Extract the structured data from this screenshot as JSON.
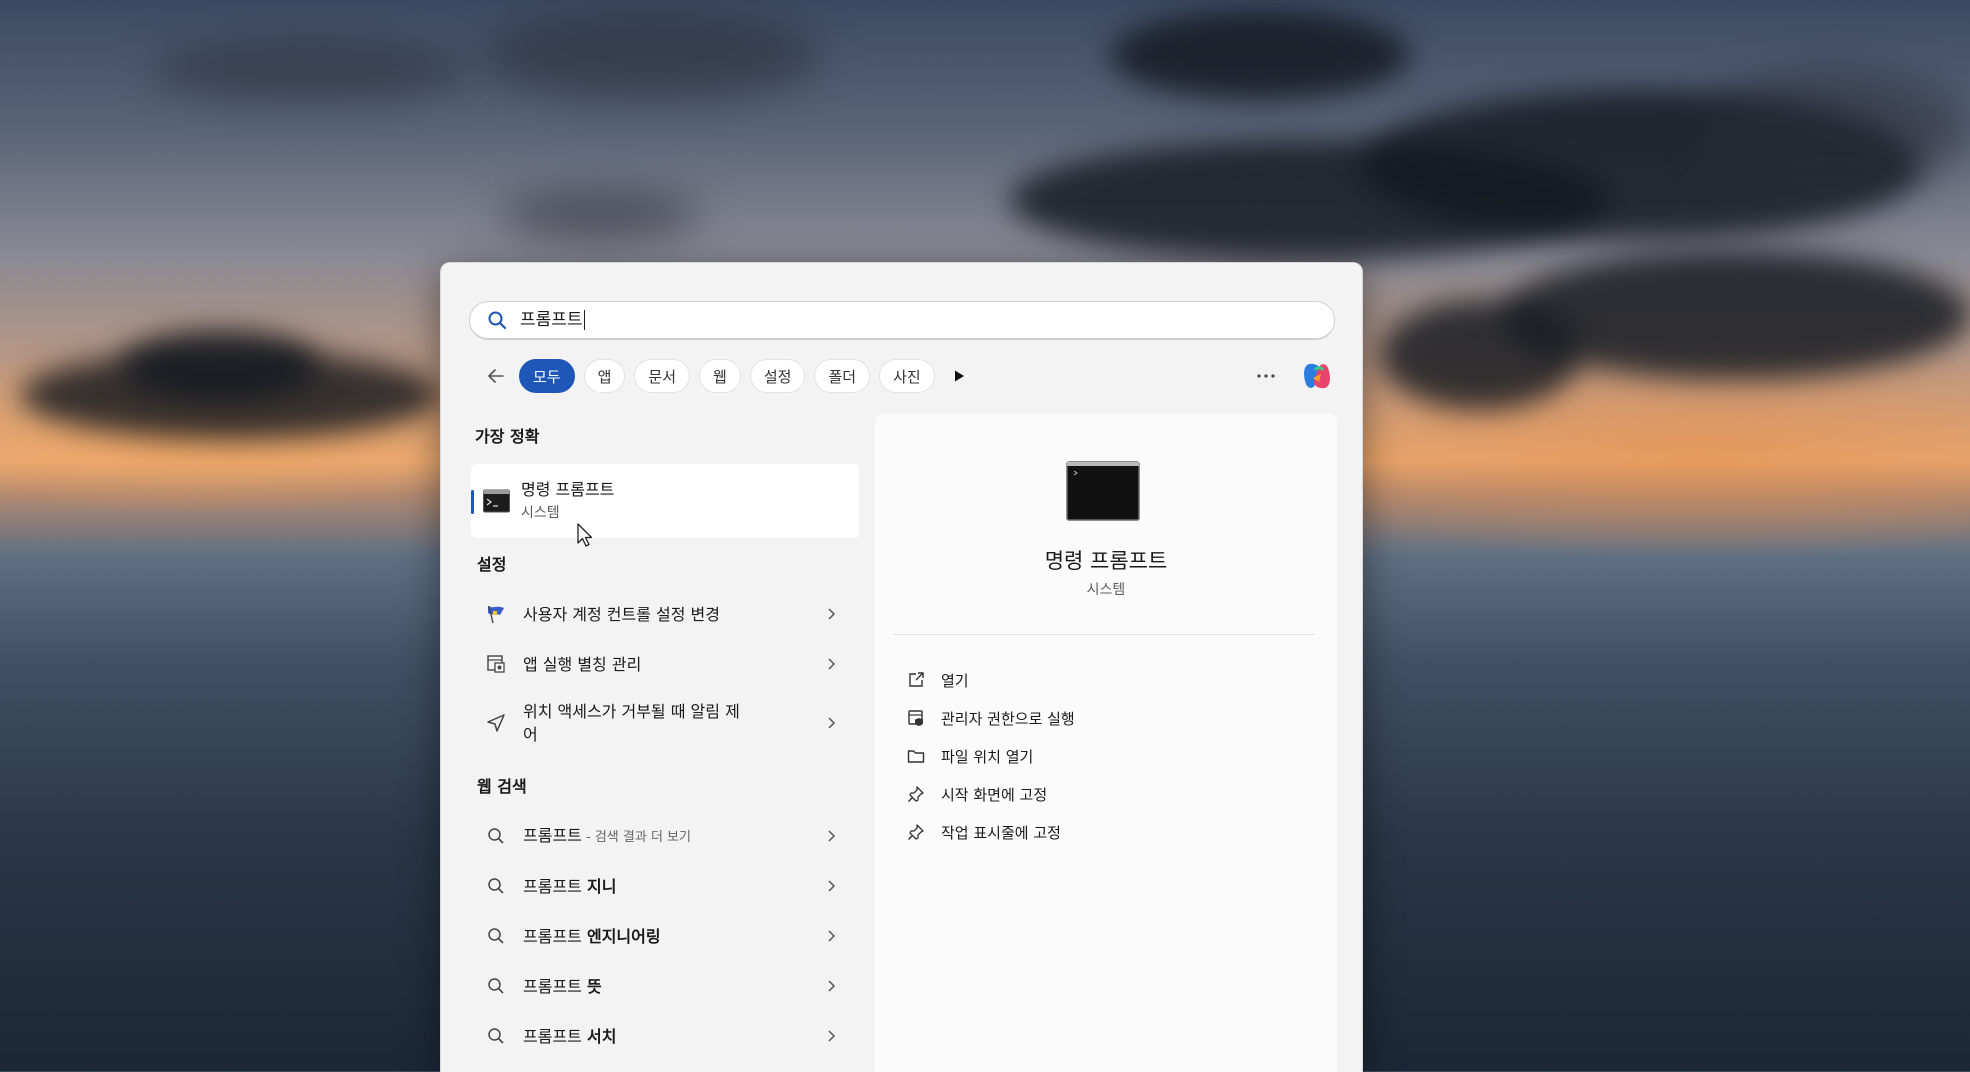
{
  "search": {
    "query": "프롬프트"
  },
  "filters": {
    "back_icon": "arrow-left-icon",
    "chips": [
      "모두",
      "앱",
      "문서",
      "웹",
      "설정",
      "폴더",
      "사진"
    ],
    "active_chip": "모두",
    "more_icon": "play-triangle-icon",
    "overflow_icon": "ellipsis-icon",
    "copilot_icon": "copilot-icon"
  },
  "best_match": {
    "heading": "가장 정확",
    "title": "명령 프롬프트",
    "subtitle": "시스템",
    "icon": "command-prompt-icon"
  },
  "settings": {
    "heading": "설정",
    "items": [
      {
        "label": "사용자 계정 컨트롤 설정 변경",
        "icon": "uac-flag-icon"
      },
      {
        "label": "앱 실행 별칭 관리",
        "icon": "app-alias-icon"
      },
      {
        "label": "위치 액세스가 거부될 때 알림 제",
        "label2": "어",
        "icon": "location-arrow-icon"
      }
    ]
  },
  "web_search": {
    "heading": "웹 검색",
    "items": [
      {
        "label": "프롬프트",
        "suffix": " - 검색 결과 더 보기"
      },
      {
        "label": "프롬프트 ",
        "bold": "지니"
      },
      {
        "label": "프롬프트 ",
        "bold": "엔지니어링"
      },
      {
        "label": "프롬프트 ",
        "bold": "뜻"
      },
      {
        "label": "프롬프트 ",
        "bold": "서치"
      }
    ]
  },
  "detail": {
    "title": "명령 프롬프트",
    "subtitle": "시스템",
    "actions": [
      {
        "label": "열기",
        "icon": "open-external-icon"
      },
      {
        "label": "관리자 권한으로 실행",
        "icon": "admin-shield-icon"
      },
      {
        "label": "파일 위치 열기",
        "icon": "folder-icon"
      },
      {
        "label": "시작 화면에 고정",
        "icon": "pin-icon"
      },
      {
        "label": "작업 표시줄에 고정",
        "icon": "pin-icon"
      }
    ]
  },
  "colors": {
    "accent": "#1f57b8",
    "panel": "#f3f3f3"
  }
}
